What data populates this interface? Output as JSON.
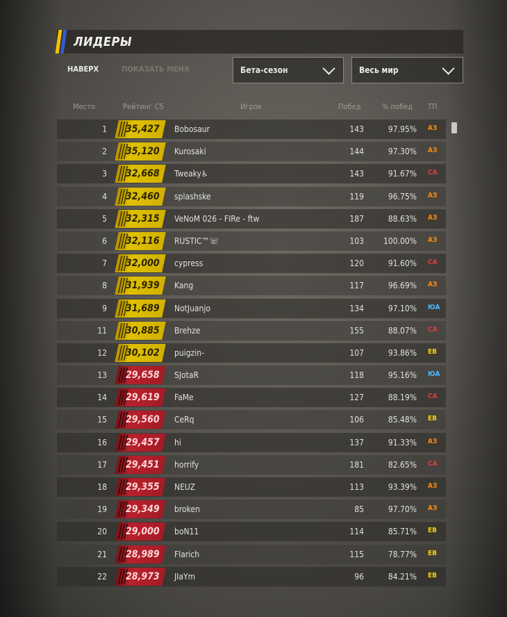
{
  "header": {
    "title": "ЛИДЕРЫ"
  },
  "links": {
    "top": "НАВЕРХ",
    "show_me": "ПОКАЗАТЬ МЕНЯ"
  },
  "filters": {
    "season": "Бета-сезон",
    "region": "Весь мир"
  },
  "columns": {
    "place": "Место",
    "rating": "Рейтинг CS",
    "player": "Игрок",
    "wins": "Побед",
    "win_pct": "% побед",
    "region": "ТП"
  },
  "colors": {
    "gold_tier": "#e0c100",
    "red_tier": "#b8202c",
    "region_as": "#ff8a00",
    "region_sa": "#e23b3b",
    "region_na": "#4fb7ff",
    "region_eu": "#f5d000"
  },
  "rows": [
    {
      "place": "1",
      "rating": "35,427",
      "player": "Bobosaur",
      "wins": "143",
      "pct": "97.95%",
      "region": "АЗ",
      "tier": "gold"
    },
    {
      "place": "2",
      "rating": "35,120",
      "player": "Kurosaki",
      "wins": "144",
      "pct": "97.30%",
      "region": "АЗ",
      "tier": "gold"
    },
    {
      "place": "3",
      "rating": "32,668",
      "player": "Tweaky♿",
      "wins": "143",
      "pct": "91.67%",
      "region": "СА",
      "tier": "gold"
    },
    {
      "place": "4",
      "rating": "32,460",
      "player": "splashske",
      "wins": "119",
      "pct": "96.75%",
      "region": "АЗ",
      "tier": "gold"
    },
    {
      "place": "5",
      "rating": "32,315",
      "player": "VeNoM 026 - FIRe - ftw",
      "wins": "187",
      "pct": "88.63%",
      "region": "АЗ",
      "tier": "gold"
    },
    {
      "place": "6",
      "rating": "32,116",
      "player": "RUSTIC™☏",
      "wins": "103",
      "pct": "100.00%",
      "region": "АЗ",
      "tier": "gold"
    },
    {
      "place": "7",
      "rating": "32,000",
      "player": "cypress",
      "wins": "120",
      "pct": "91.60%",
      "region": "СА",
      "tier": "gold"
    },
    {
      "place": "8",
      "rating": "31,939",
      "player": "Kang",
      "wins": "117",
      "pct": "96.69%",
      "region": "АЗ",
      "tier": "gold"
    },
    {
      "place": "9",
      "rating": "31,689",
      "player": "NotJuanjo",
      "wins": "134",
      "pct": "97.10%",
      "region": "ЮА",
      "tier": "gold"
    },
    {
      "place": "11",
      "rating": "30,885",
      "player": "Brehze",
      "wins": "155",
      "pct": "88.07%",
      "region": "СА",
      "tier": "gold"
    },
    {
      "place": "12",
      "rating": "30,102",
      "player": "puigzin-",
      "wins": "107",
      "pct": "93.86%",
      "region": "ЕВ",
      "tier": "gold"
    },
    {
      "place": "13",
      "rating": "29,658",
      "player": "SJotaR",
      "wins": "118",
      "pct": "95.16%",
      "region": "ЮА",
      "tier": "red"
    },
    {
      "place": "14",
      "rating": "29,619",
      "player": "FaMe",
      "wins": "127",
      "pct": "88.19%",
      "region": "СА",
      "tier": "red"
    },
    {
      "place": "15",
      "rating": "29,560",
      "player": "CeRq",
      "wins": "106",
      "pct": "85.48%",
      "region": "ЕВ",
      "tier": "red"
    },
    {
      "place": "16",
      "rating": "29,457",
      "player": "hi",
      "wins": "137",
      "pct": "91.33%",
      "region": "АЗ",
      "tier": "red"
    },
    {
      "place": "17",
      "rating": "29,451",
      "player": "horrify",
      "wins": "181",
      "pct": "82.65%",
      "region": "СА",
      "tier": "red"
    },
    {
      "place": "18",
      "rating": "29,355",
      "player": "NEUZ",
      "wins": "113",
      "pct": "93.39%",
      "region": "АЗ",
      "tier": "red"
    },
    {
      "place": "19",
      "rating": "29,349",
      "player": "broken",
      "wins": "85",
      "pct": "97.70%",
      "region": "АЗ",
      "tier": "red"
    },
    {
      "place": "20",
      "rating": "29,000",
      "player": "boN11",
      "wins": "114",
      "pct": "85.71%",
      "region": "ЕВ",
      "tier": "red"
    },
    {
      "place": "21",
      "rating": "28,989",
      "player": "Flarich",
      "wins": "115",
      "pct": "78.77%",
      "region": "ЕВ",
      "tier": "red"
    },
    {
      "place": "22",
      "rating": "28,973",
      "player": "JIaYm",
      "wins": "96",
      "pct": "84.21%",
      "region": "ЕВ",
      "tier": "red"
    }
  ]
}
